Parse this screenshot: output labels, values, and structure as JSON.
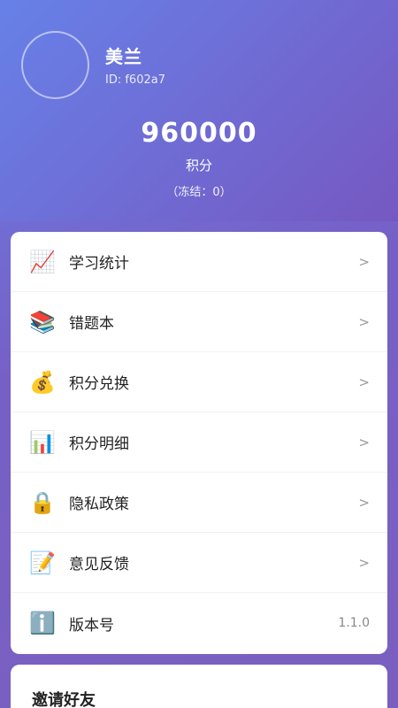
{
  "profile": {
    "name": "美兰",
    "id_text": "ID: f602a7",
    "points": "960000",
    "points_label": "积分",
    "frozen_text": "（冻结：0）"
  },
  "menu": {
    "items": [
      {
        "icon": "📈",
        "icon_name": "chart-up-icon",
        "label": "学习统计",
        "right": ">"
      },
      {
        "icon": "📚",
        "icon_name": "books-icon",
        "label": "错题本",
        "right": ">"
      },
      {
        "icon": "💰",
        "icon_name": "money-bag-icon",
        "label": "积分兑换",
        "right": ">"
      },
      {
        "icon": "📊",
        "icon_name": "bar-chart-icon",
        "label": "积分明细",
        "right": ">"
      },
      {
        "icon": "🔒",
        "icon_name": "lock-icon",
        "label": "隐私政策",
        "right": ">"
      },
      {
        "icon": "📝",
        "icon_name": "memo-icon",
        "label": "意见反馈",
        "right": ">"
      },
      {
        "icon": "ℹ️",
        "icon_name": "info-icon",
        "label": "版本号",
        "right": "1.1.0"
      }
    ]
  },
  "invite": {
    "title": "邀请好友"
  }
}
